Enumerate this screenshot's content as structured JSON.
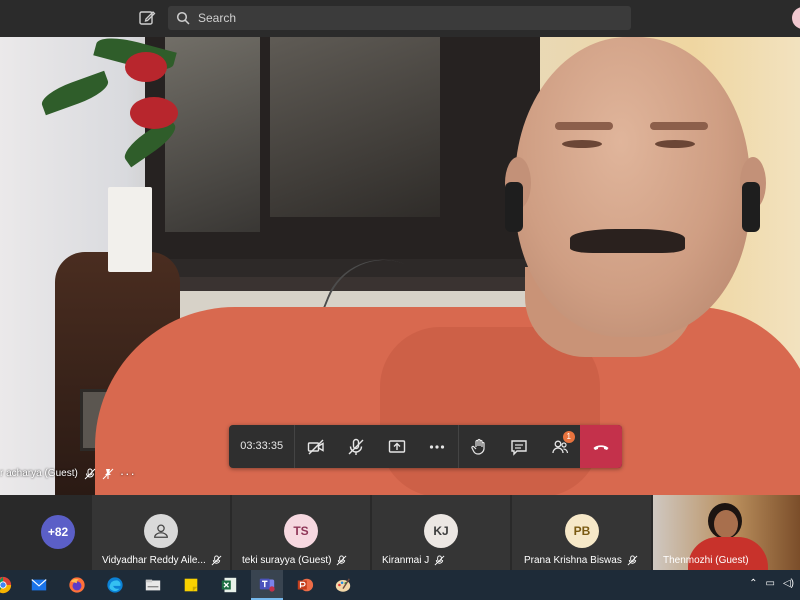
{
  "topbar": {
    "search_placeholder": "Search"
  },
  "main_video": {
    "name_label": "r acharya (Guest)"
  },
  "controls": {
    "timer": "03:33:35",
    "participants_badge": "1"
  },
  "participants": {
    "overflow_count": "+82",
    "tiles": [
      {
        "initials": "",
        "name": "Vidyadhar Reddy Aile..."
      },
      {
        "initials": "TS",
        "name": "teki surayya (Guest)"
      },
      {
        "initials": "KJ",
        "name": "Kiranmai J"
      },
      {
        "initials": "PB",
        "name": "Prana Krishna Biswas"
      },
      {
        "initials": "",
        "name": "Thenmozhi (Guest)"
      }
    ]
  },
  "colors": {
    "hangup": "#c4314b",
    "badge": "#e8733e",
    "avatar_overflow": "#5b5fc7",
    "avatar_ts": "#f6d8e0",
    "avatar_kj": "#ece7e3",
    "avatar_pb": "#f6e8c8"
  },
  "icons": [
    "compose-icon",
    "search-icon",
    "camera-off-icon",
    "mic-off-icon",
    "share-screen-icon",
    "more-icon",
    "raise-hand-icon",
    "chat-icon",
    "participants-icon",
    "hangup-icon"
  ]
}
